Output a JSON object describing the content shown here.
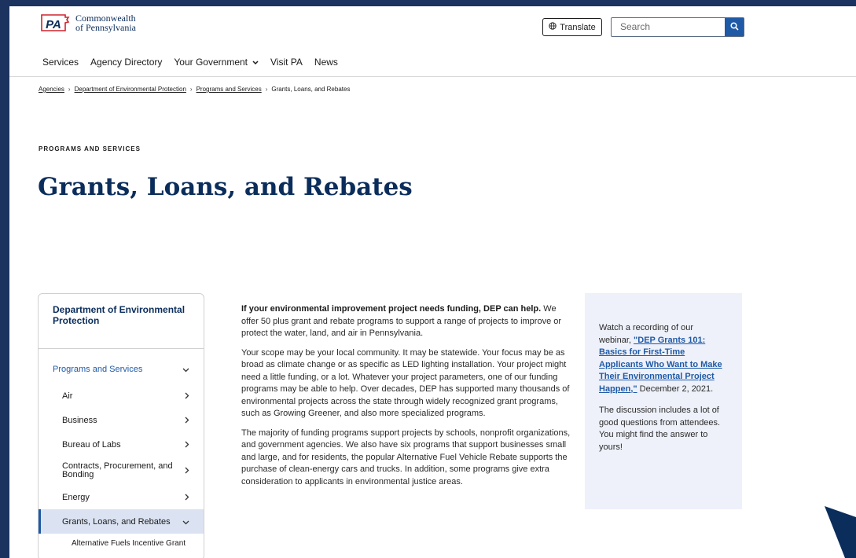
{
  "brand": {
    "line1": "Commonwealth",
    "line2": "of Pennsylvania",
    "mark": "PA"
  },
  "header": {
    "translate_label": "Translate",
    "search_placeholder": "Search"
  },
  "nav": {
    "items": [
      {
        "label": "Services"
      },
      {
        "label": "Agency Directory"
      },
      {
        "label": "Your Government"
      },
      {
        "label": "Visit PA"
      },
      {
        "label": "News"
      }
    ]
  },
  "breadcrumbs": {
    "items": [
      {
        "label": "Agencies"
      },
      {
        "label": "Department of Environmental Protection"
      },
      {
        "label": "Programs and Services"
      },
      {
        "label": "Grants, Loans, and Rebates"
      }
    ]
  },
  "page": {
    "eyebrow": "PROGRAMS AND SERVICES",
    "title": "Grants, Loans, and Rebates"
  },
  "sidebar": {
    "title": "Department of Environmental Protection",
    "section": "Programs and Services",
    "items": [
      {
        "label": "Air"
      },
      {
        "label": "Business"
      },
      {
        "label": "Bureau of Labs"
      },
      {
        "label": "Contracts, Procurement, and Bonding"
      },
      {
        "label": "Energy"
      },
      {
        "label": "Grants, Loans, and Rebates"
      }
    ],
    "sub_item": "Alternative Fuels Incentive Grant"
  },
  "content": {
    "intro_bold": "If your environmental improvement project needs funding, DEP can help.",
    "intro_rest": " We offer 50 plus grant and rebate programs to support a range of projects to improve or protect the water, land, and air in Pennsylvania.",
    "para2": "Your scope may be your local community. It may be statewide. Your focus may be as broad as climate change or as specific as LED lighting installation. Your project might need a little funding, or a lot. Whatever your project parameters, one of our funding programs may be able to help. Over decades, DEP has supported many thousands of environmental projects across the state through widely recognized grant programs, such as Growing Greener, and also more specialized programs.",
    "para3": "The majority of funding programs support projects by schools, nonprofit organizations, and government agencies. We also have six programs that support businesses small and large, and for residents, the popular Alternative Fuel Vehicle Rebate supports the purchase of clean-energy cars and trucks. In addition, some programs give extra consideration to applicants in environmental justice areas."
  },
  "callout": {
    "lead": "Watch a recording of our webinar, ",
    "link": "\"DEP Grants 101: Basics for First-Time Applicants Who Want to Make Their Environmental Project Happen,\"",
    "tail": " December 2, 2021.",
    "para2": "The discussion includes a lot of good questions from attendees. You might find the answer to yours!"
  },
  "colors": {
    "brand_navy": "#0b2d5b",
    "link_blue": "#1f5aa6",
    "frame_bg": "#1c3360",
    "callout_bg": "#eef1fa"
  },
  "icons": {
    "translate": "globe-icon",
    "search": "search-icon",
    "nav_dropdown": "chevron-down-icon",
    "sidebar_item": "chevron-right-icon"
  }
}
